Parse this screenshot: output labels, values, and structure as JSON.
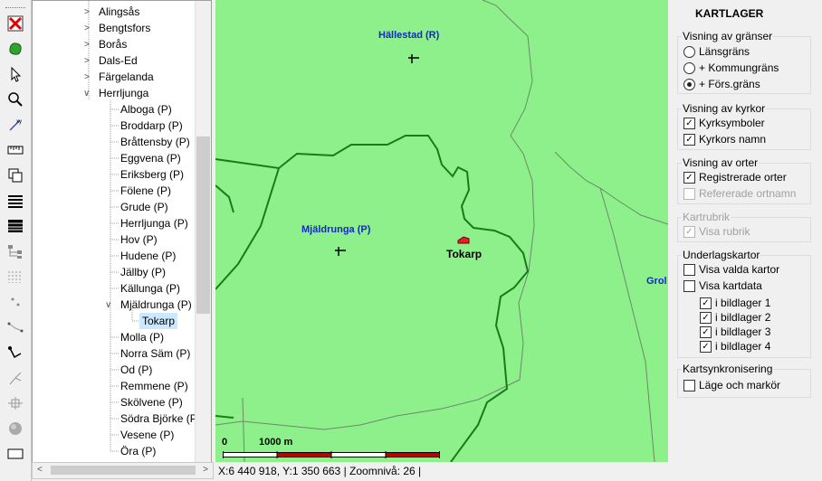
{
  "toolbar": {
    "tools": [
      "close-red-x-icon",
      "leaf-icon",
      "cursor-icon",
      "zoom-icon",
      "coordinate-tool-icon",
      "ruler-icon",
      "layers-copy-icon",
      "list-icon",
      "table-icon",
      "tree-icon",
      "dotted-list-icon",
      "point-icon",
      "line-tool-icon",
      "connect-tool-icon",
      "branch-tool-icon",
      "split-tool-icon",
      "sphere-icon",
      "rectangle-icon"
    ]
  },
  "tree": {
    "top_items": [
      "Alingsås",
      "Bengtsfors",
      "Borås",
      "Dals-Ed",
      "Färgelanda"
    ],
    "expanded_label": "Herrljunga",
    "children": [
      "Alboga (P)",
      "Broddarp (P)",
      "Bråttensby (P)",
      "Eggvena (P)",
      "Eriksberg (P)",
      "Fölene (P)",
      "Grude (P)",
      "Herrljunga (P)",
      "Hov (P)",
      "Hudene (P)",
      "Jällby (P)",
      "Källunga (P)"
    ],
    "expanded_child": "Mjäldrunga (P)",
    "selected_item": "Tokarp",
    "after_children": [
      "Molla (P)",
      "Norra Säm (P)",
      "Od (P)",
      "Remmene (P)",
      "Skölvene (P)",
      "Södra Björke (P)",
      "Vesene (P)",
      "Öra (P)"
    ]
  },
  "map": {
    "labels": {
      "hallestad": "Hällestad (R)",
      "mjaldrunga": "Mjäldrunga (P)",
      "tokarp": "Tokarp",
      "grol": "Grol"
    },
    "scale": {
      "zero": "0",
      "distance": "1000 m"
    },
    "colors": {
      "land": "#8ef08a",
      "border": "#1a7a1a",
      "label_blue": "#1428c8",
      "scale_red": "#c00000"
    }
  },
  "status": "X:6 440 918, Y:1 350 663  |  Zoomnivå: 26  |",
  "panel": {
    "title": "KARTLAGER",
    "groups": {
      "granser": {
        "label": "Visning av gränser",
        "options": [
          "Länsgräns",
          "+ Kommungräns",
          "+ Förs.gräns"
        ],
        "selected": "+ Förs.gräns"
      },
      "kyrkor": {
        "label": "Visning av kyrkor",
        "options": [
          {
            "label": "Kyrksymboler",
            "checked": true
          },
          {
            "label": "Kyrkors namn",
            "checked": true
          }
        ]
      },
      "orter": {
        "label": "Visning av orter",
        "options": [
          {
            "label": "Registrerade orter",
            "checked": true,
            "disabled": false
          },
          {
            "label": "Refererade ortnamn",
            "checked": false,
            "disabled": true
          }
        ]
      },
      "rubrik": {
        "label": "Kartrubrik",
        "options": [
          {
            "label": "Visa rubrik",
            "checked": true,
            "disabled": true
          }
        ]
      },
      "underlag": {
        "label": "Underlagskartor",
        "options": [
          {
            "label": "Visa valda kartor",
            "checked": false
          },
          {
            "label": "Visa kartdata",
            "checked": false
          }
        ],
        "sublayers": [
          {
            "label": "i bildlager 1",
            "checked": true
          },
          {
            "label": "i bildlager 2",
            "checked": true
          },
          {
            "label": "i bildlager 3",
            "checked": true
          },
          {
            "label": "i bildlager 4",
            "checked": true
          }
        ]
      },
      "synk": {
        "label": "Kartsynkronisering",
        "options": [
          {
            "label": "Läge och markör",
            "checked": false
          }
        ]
      }
    }
  }
}
